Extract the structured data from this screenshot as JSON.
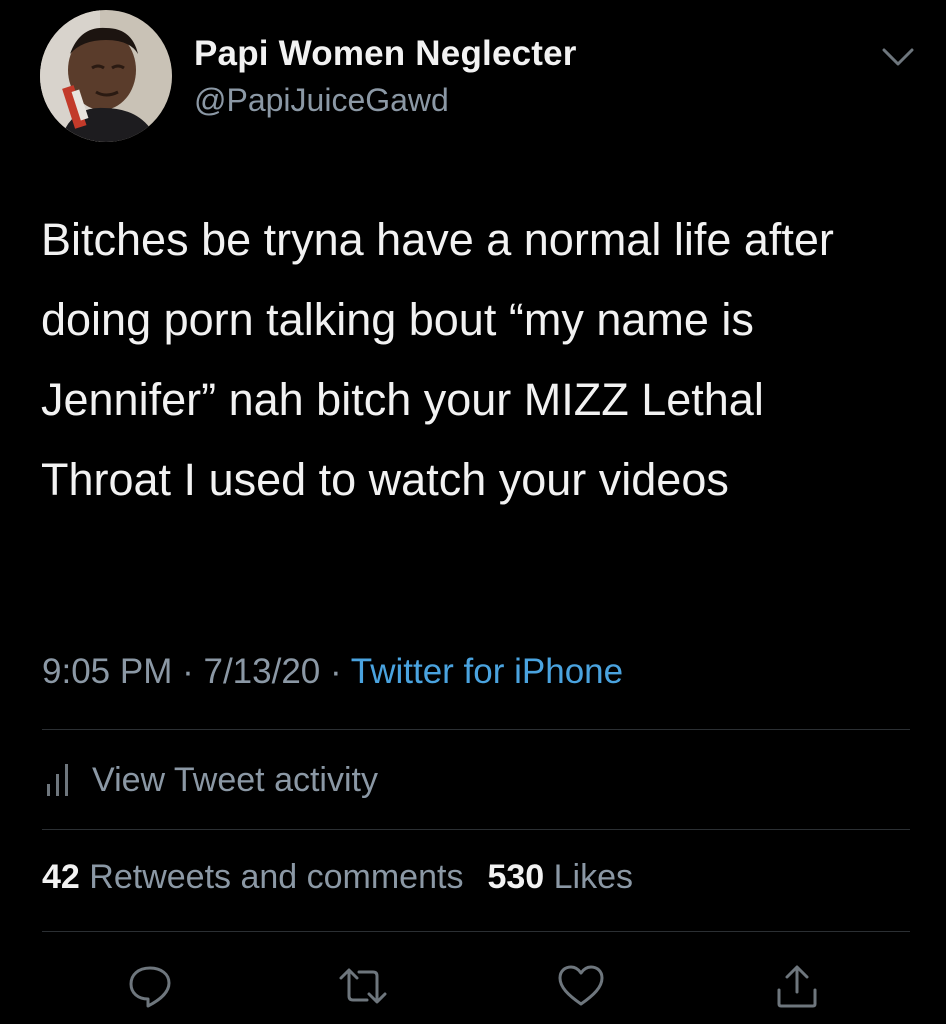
{
  "author": {
    "display_name": "Papi Women Neglecter",
    "handle": "@PapiJuiceGawd"
  },
  "tweet": {
    "text": "Bitches be tryna have a normal life after doing porn talking bout “my name is Jennifer” nah bitch your MIZZ Lethal Throat I used to watch your videos",
    "time": "9:05 PM",
    "date": "7/13/20",
    "separator": "·",
    "source": "Twitter for iPhone"
  },
  "activity": {
    "label": "View Tweet activity",
    "icon": "bar-chart-icon"
  },
  "stats": {
    "retweets_count": "42",
    "retweets_label": "Retweets and comments",
    "likes_count": "530",
    "likes_label": "Likes"
  },
  "actions": {
    "icons": [
      "reply-icon",
      "retweet-icon",
      "like-icon",
      "share-icon"
    ]
  },
  "colors": {
    "background": "#000000",
    "primary_text": "#f2f2f2",
    "secondary_text": "#8b98a5",
    "link": "#4aa3df",
    "divider": "#2b2f33"
  }
}
